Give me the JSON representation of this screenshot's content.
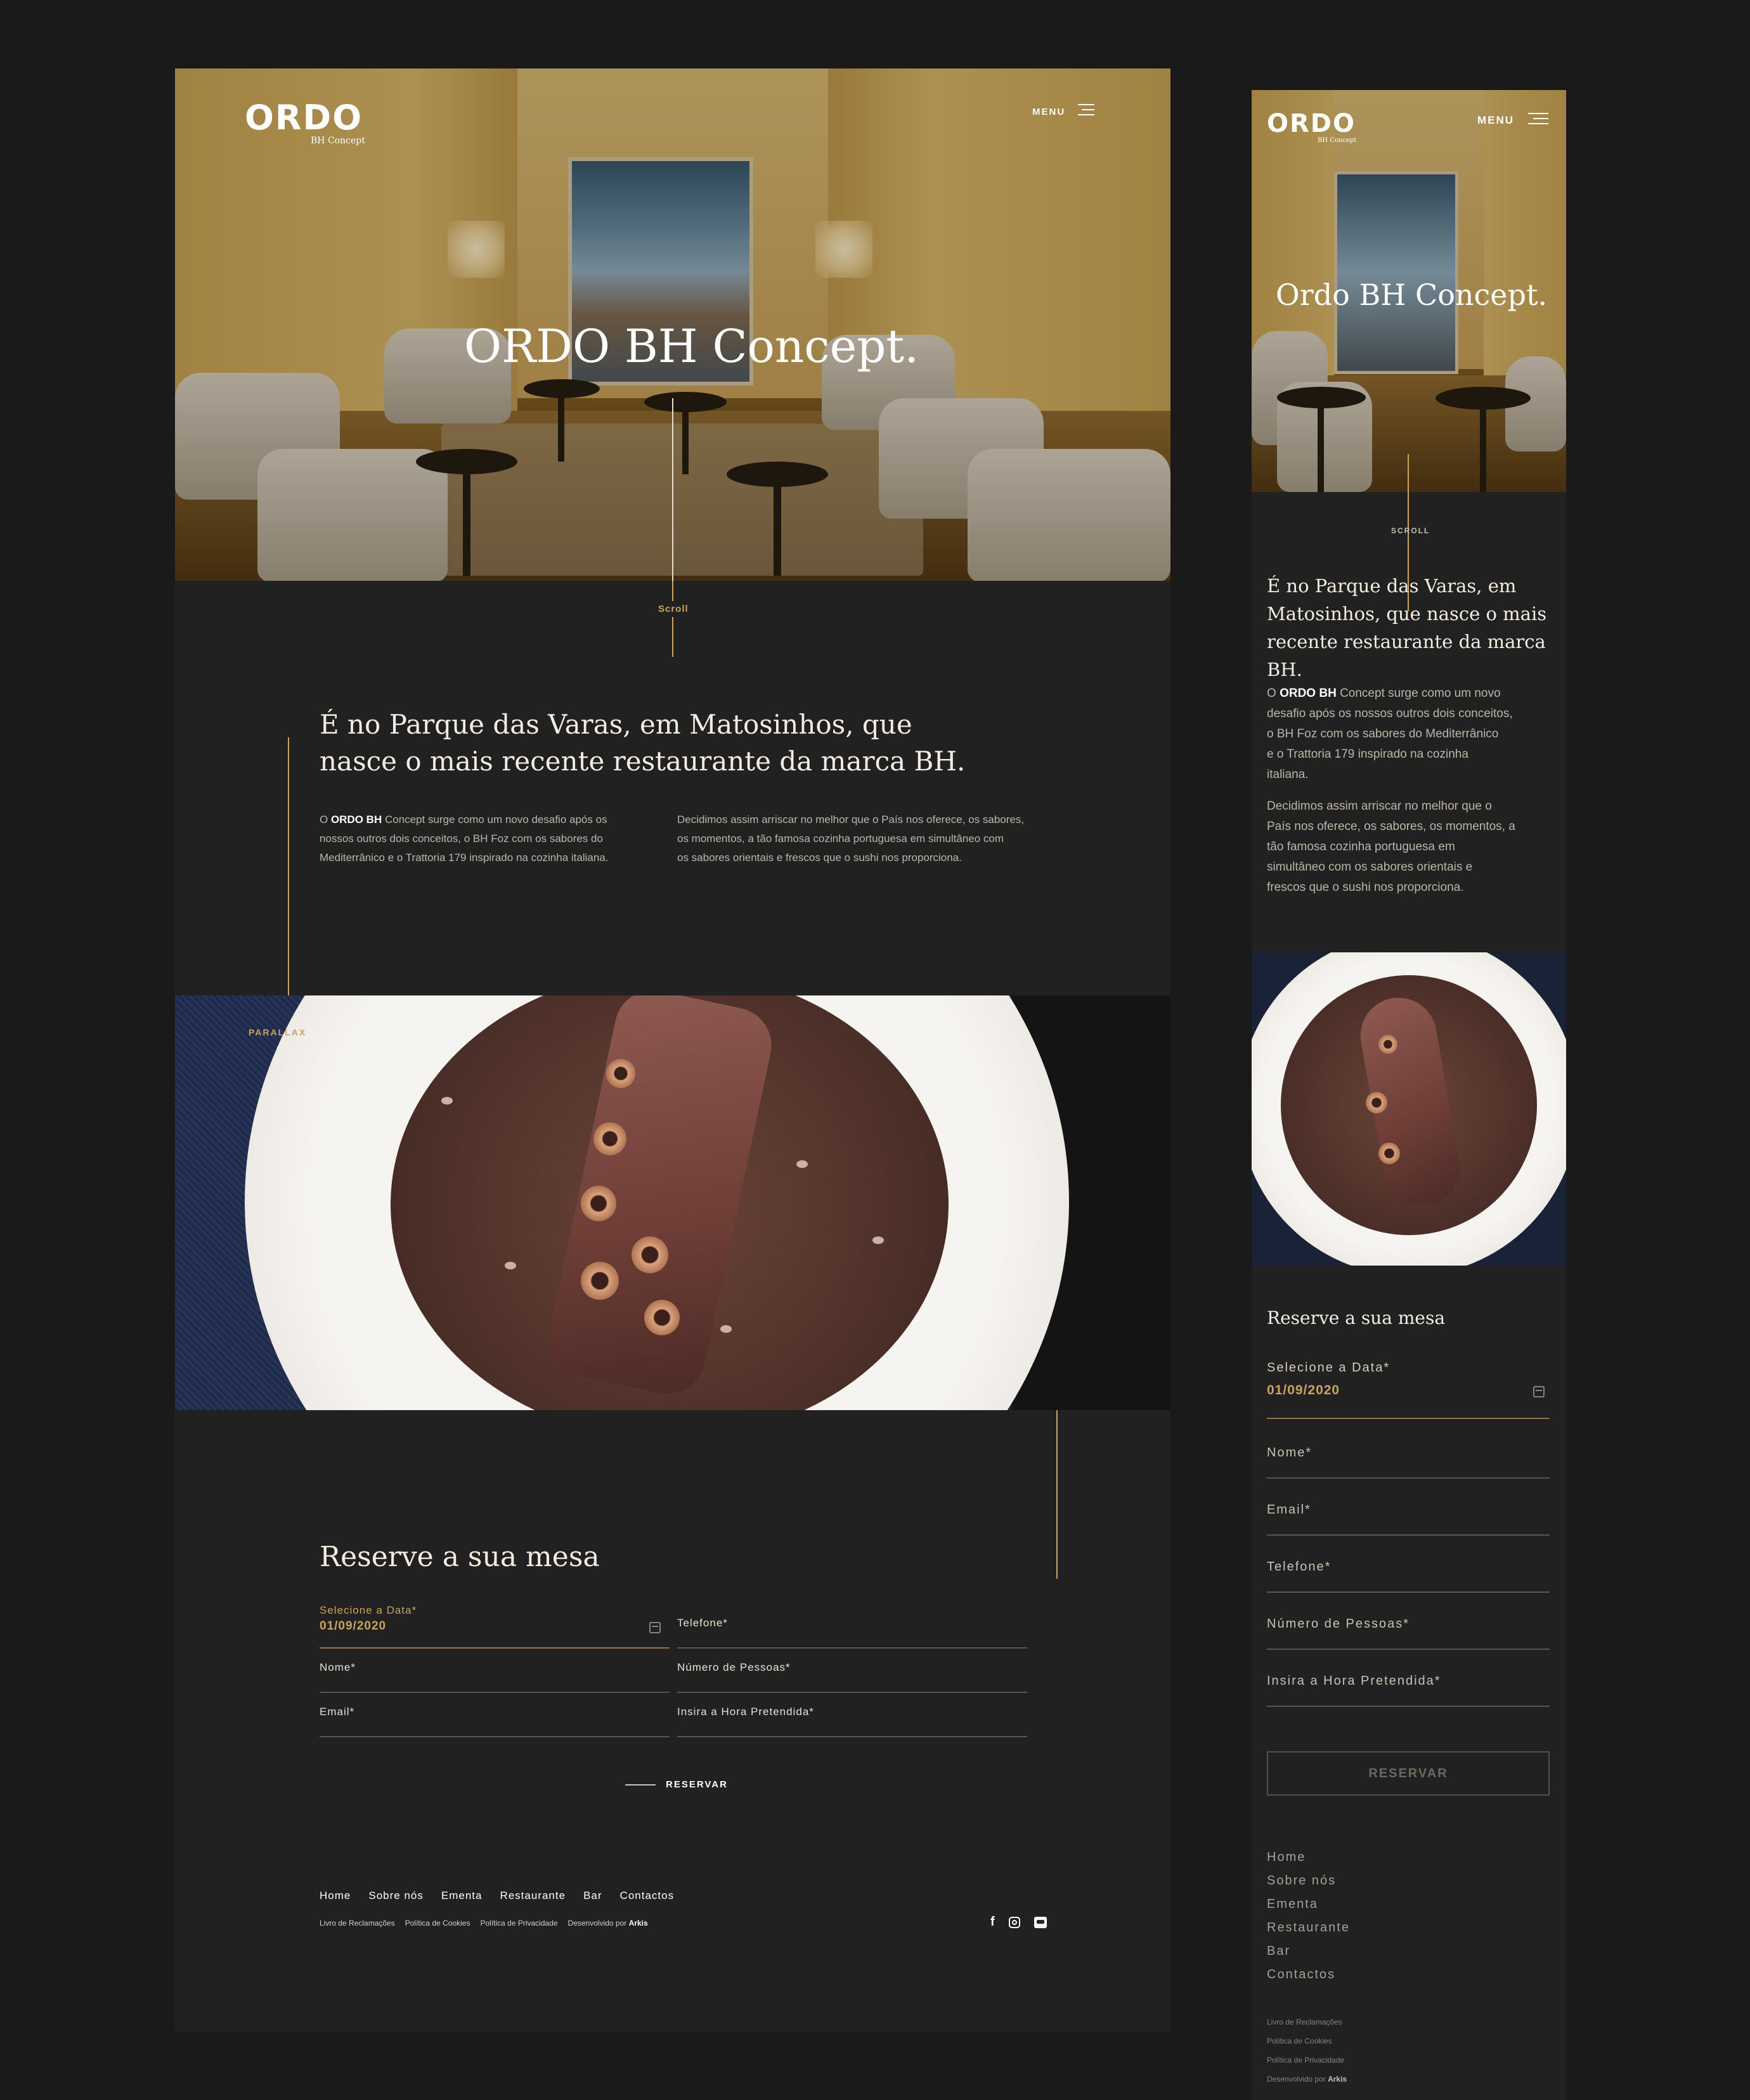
{
  "desktop": {
    "logo": {
      "main": "ORDO",
      "sub": "BH Concept"
    },
    "menu_label": "MENU",
    "hero_title": "ORDO BH Concept.",
    "scroll_label": "Scroll",
    "intro": {
      "heading_line1": "É no Parque das Varas, em Matosinhos, que",
      "heading_line2": "nasce o mais recente restaurante da marca BH.",
      "col1_prefix": "O ",
      "col1_brand": "ORDO BH",
      "col1_line1": " Concept surge como um novo desafio após os",
      "col1_line2": "nossos outros dois conceitos, o BH Foz com os sabores do",
      "col1_line3": "Mediterrânico  e o Trattoria 179 inspirado na cozinha italiana.",
      "col2_line1": "Decidimos assim arriscar no melhor que o País nos oferece, os sabores,",
      "col2_line2": "os momentos, a tão famosa cozinha portuguesa em simultâneo com",
      "col2_line3": "os sabores orientais e frescos que o sushi nos proporciona."
    },
    "parallax_label": "PARALLAX",
    "reservation": {
      "title": "Reserve a sua mesa",
      "date_label": "Selecione a Data*",
      "date_value": "01/09/2020",
      "name": "Nome*",
      "email": "Email*",
      "phone": "Telefone*",
      "people": "Número de Pessoas*",
      "time": "Insira a Hora Pretendida*",
      "submit": "RESERVAR"
    },
    "footer": {
      "links": [
        "Home",
        "Sobre nós",
        "Ementa",
        "Restaurante",
        "Bar",
        "Contactos"
      ],
      "legal": [
        "Livro de Reclamações",
        "Política de Cookies",
        "Política de Privacidade"
      ],
      "dev_prefix": "Desenvolvido por",
      "dev_name": "Arkis"
    }
  },
  "mobile": {
    "logo": {
      "main": "ORDO",
      "sub": "BH Concept"
    },
    "menu_label": "MENU",
    "hero_title": "Ordo BH Concept.",
    "scroll_label": "SCROLL",
    "intro": {
      "heading_line1": "É no Parque das Varas, em",
      "heading_line2": "Matosinhos, que nasce o mais",
      "heading_line3": "recente restaurante da marca BH.",
      "p1_prefix": "O ",
      "p1_brand": "ORDO BH",
      "p1_line1": " Concept surge como um novo",
      "p1_line2": "desafio após os nossos outros dois conceitos,",
      "p1_line3": "o BH Foz com os sabores do Mediterrânico",
      "p1_line4": "e o Trattoria 179 inspirado na cozinha",
      "p1_line5": "italiana.",
      "p2_line1": "Decidimos assim arriscar no melhor que o",
      "p2_line2": "País nos oferece, os sabores, os momentos, a",
      "p2_line3": "tão famosa cozinha portuguesa em",
      "p2_line4": "simultâneo com os sabores orientais e",
      "p2_line5": "frescos que o sushi nos proporciona."
    },
    "reservation": {
      "title": "Reserve a sua mesa",
      "date_label": "Selecione a Data*",
      "date_value": "01/09/2020",
      "name": "Nome*",
      "email": "Email*",
      "phone": "Telefone*",
      "people": "Número de Pessoas*",
      "time": "Insira a Hora Pretendida*",
      "submit": "RESERVAR"
    },
    "footer": {
      "links": [
        "Home",
        "Sobre nós",
        "Ementa",
        "Restaurante",
        "Bar",
        "Contactos"
      ],
      "legal": [
        "Livro de Reclamações",
        "Política de Cookies",
        "Política de Privacidade"
      ],
      "dev_prefix": "Desenvolvido por",
      "dev_name": "Arkis"
    }
  },
  "icons": [
    "facebook-icon",
    "instagram-icon",
    "tripadvisor-icon",
    "calendar-icon",
    "hamburger-icon"
  ]
}
